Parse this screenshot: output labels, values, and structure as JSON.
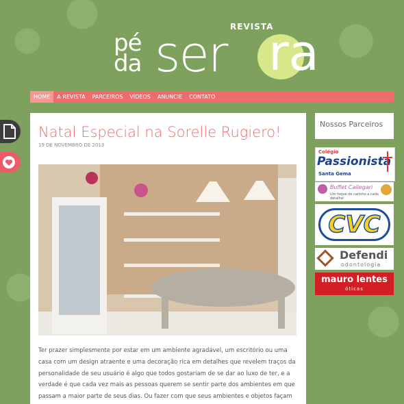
{
  "logo": {
    "revista": "REVISTA",
    "pe": "pé",
    "da": "da",
    "serra_part": "ser",
    "serra_end": "ra"
  },
  "nav": {
    "items": [
      "HOME",
      "A REVISTA",
      "PARCEIROS",
      "VÍDEOS",
      "ANUNCIE",
      "CONTATO"
    ]
  },
  "post": {
    "title": "Natal Especial na Sorelle Rugiero!",
    "date": "19 DE NOVEMBRO DE 2013",
    "body": "Ter prazer simplesmente por estar em um ambiente agradável, um escritório ou uma casa com um design atraente e uma decoração rica em detalhes que revelem traços da personalidade de seu usuário é algo que todos gostariam de se dar ao luxo de ter, e a verdade é que cada vez mais as pessoas querem se sentir parte dos ambientes em que passam a maior parte de seus dias. Ou fazer com que seus ambientes e objetos façam"
  },
  "sidebar": {
    "title": "Nossos Parceiros",
    "ads": [
      {
        "line1": "Colégio",
        "line2": "Passionista",
        "line3": "Santa Gema"
      },
      {
        "line1": "Buffet Callegari",
        "line2": "Um toque de carinho a cada detalhe!"
      },
      {
        "line1": "CVC"
      },
      {
        "line1": "Defendi",
        "line2": "odontologia"
      },
      {
        "line1": "mauro lentes",
        "line2": "óticas"
      }
    ]
  },
  "colors": {
    "accent": "#ee6d6c",
    "background": "#7ea25e",
    "highlight": "#d6e88a"
  }
}
